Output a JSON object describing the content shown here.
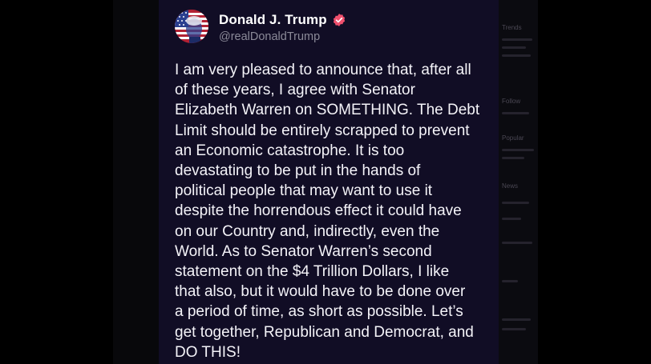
{
  "post": {
    "author_name": "Donald J. Trump",
    "author_handle": "@realDonaldTrump",
    "text": "I am very pleased to announce that, after all\nof these years, I agree with Senator\nElizabeth Warren on SOMETHING. The Debt\nLimit should be entirely scrapped to prevent\nan Economic catastrophe. It is too\ndevastating to be put in the hands of\npolitical people that may want to use it\ndespite the horrendous effect it could have\non our Country and, indirectly, even the\nWorld. As to Senator Warren’s second\nstatement on the $4 Trillion Dollars, I like\nthat also, but it would have to be done over\na period of time, as short as possible. Let’s\nget together, Republican and Democrat, and\nDO THIS!",
    "verified_icon": "verified-badge-icon",
    "avatar_icon": "flag-portrait-avatar"
  },
  "colors": {
    "card_background": "#110d25",
    "verified_badge": "#f0506e",
    "handle_text": "#8b8a98"
  },
  "background_sidebar": {
    "items": [
      "Trends",
      "Follow",
      "Popular",
      "News"
    ]
  }
}
